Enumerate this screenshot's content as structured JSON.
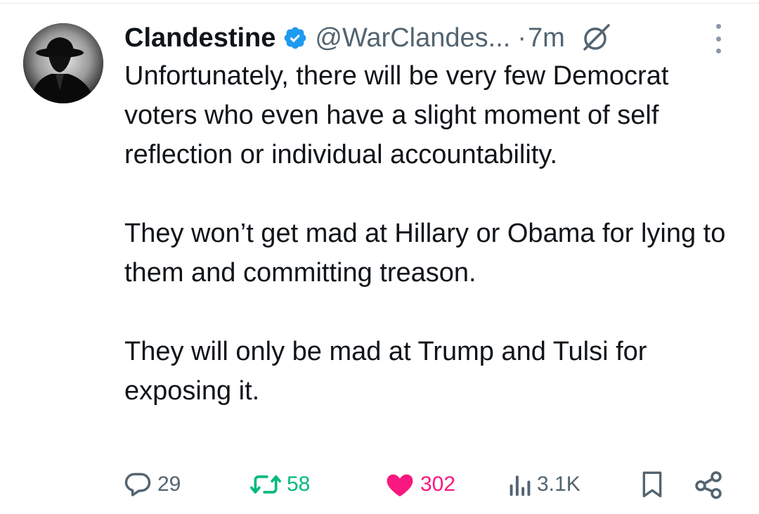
{
  "tweet": {
    "author": {
      "display_name": "Clandestine",
      "verified_icon": "verified-badge-icon",
      "handle": "@WarClandes...",
      "avatar": "fedora-silhouette-avatar"
    },
    "separator": "·",
    "time": "7m",
    "grok_icon": "grok-icon",
    "more_icon": "more-vertical-icon",
    "paragraphs": [
      "Unfortunately, there will be very few Democrat voters who even have a slight moment of self reflection or individual accountability.",
      "They won’t get mad at Hillary or Obama for lying to them and committing treason.",
      "They will only be mad at Trump and Tulsi for exposing it."
    ],
    "actions": {
      "replies": "29",
      "retweets": "58",
      "likes": "302",
      "views": "3.1K"
    },
    "colors": {
      "text": "#0f1419",
      "secondary": "#536471",
      "verified": "#1d9bf0",
      "retweet": "#00ba7c",
      "like": "#f91880"
    }
  }
}
